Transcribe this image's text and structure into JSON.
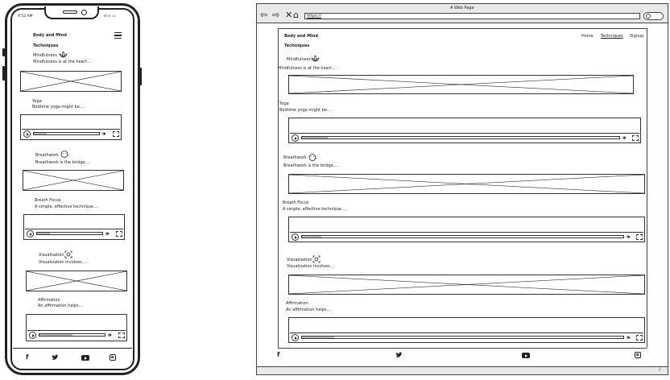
{
  "browser": {
    "title": "A Web Page",
    "url": "https://",
    "nav_back_icon": "arrow-left-icon",
    "nav_forward_icon": "arrow-right-icon",
    "stop_icon": "close-icon",
    "home_icon": "home-icon",
    "search_icon": "search-icon"
  },
  "phone": {
    "status_time": "9:52 AM",
    "status_icons": "ıll ≈ ▭"
  },
  "site": {
    "brand": "Body and Mind",
    "page_heading": "Techniques",
    "nav": [
      {
        "label": "Home"
      },
      {
        "label": "Techniques"
      },
      {
        "label": "Signup"
      }
    ],
    "sections": {
      "mindfulness": {
        "title": "Mindfulness",
        "text": "Mindfulness is at the heart....",
        "icon": "lotus-icon"
      },
      "yoga": {
        "title": "Yoga",
        "text": "Bedtime yoga might be....",
        "media": "video-player"
      },
      "breathwork": {
        "title": "Breathwork",
        "text": "Breathwork is the bridge....",
        "icon": "breath-face-icon"
      },
      "breath_focus": {
        "title": "Breath Focus",
        "text": "A simple, effective technique....",
        "media": "video-player"
      },
      "visualization": {
        "title": "Visualisation",
        "text": "Visualization involves....",
        "icon": "focus-icon"
      },
      "affirmation": {
        "title": "Affirmation",
        "text": "An affirmation helps....",
        "media": "video-player"
      }
    },
    "footer_icons": [
      "facebook-icon",
      "twitter-icon",
      "youtube-icon",
      "instagram-icon"
    ]
  }
}
